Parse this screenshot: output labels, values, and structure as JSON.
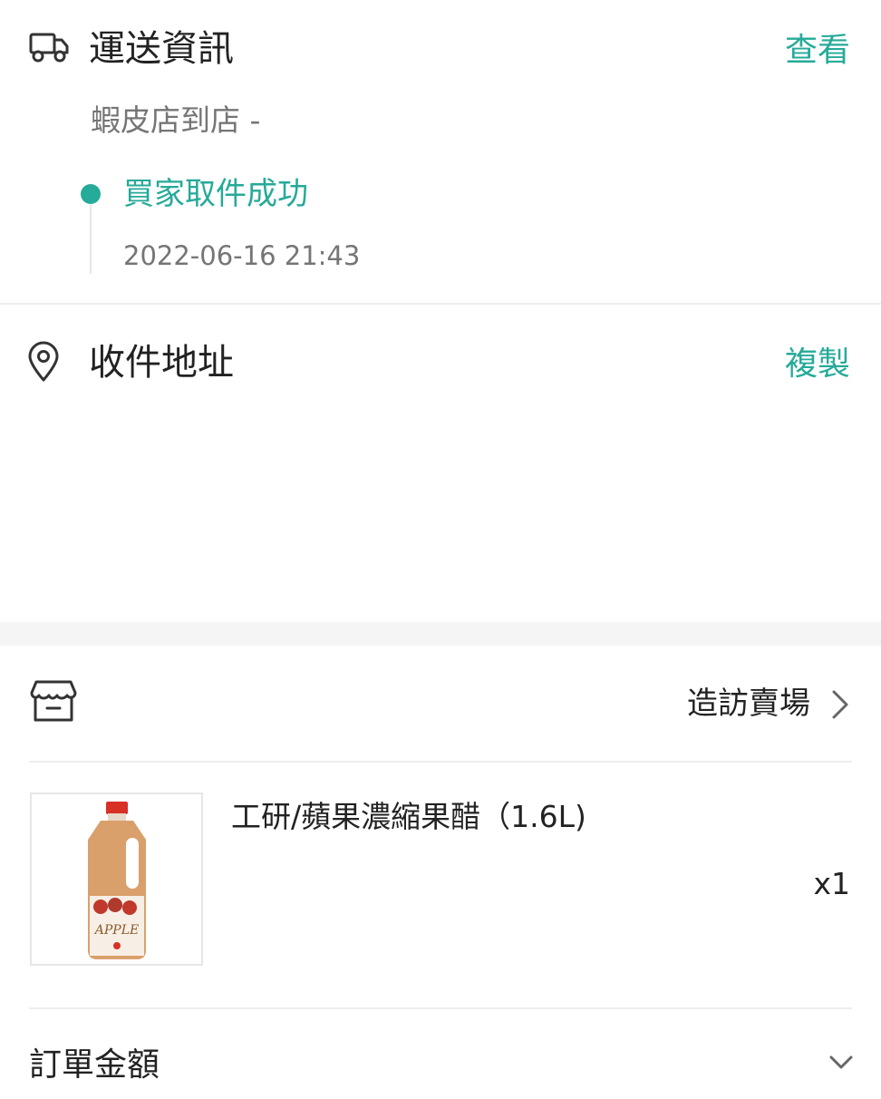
{
  "shipping": {
    "title": "運送資訊",
    "view_label": "查看",
    "method": "蝦皮店到店 -",
    "status": "買家取件成功",
    "status_time": "2022-06-16 21:43",
    "icon": "truck-icon"
  },
  "address": {
    "title": "收件地址",
    "copy_label": "複製",
    "icon": "location-pin-icon"
  },
  "shop": {
    "visit_label": "造訪賣場",
    "icon": "store-icon"
  },
  "product": {
    "name": "工研/蘋果濃縮果醋（1.6L)",
    "quantity": "x1",
    "image_label": "APPLE"
  },
  "order_total": {
    "label": "訂單金額"
  },
  "colors": {
    "accent": "#26aa99",
    "divider": "#eeeeee",
    "muted_text": "#757575"
  }
}
